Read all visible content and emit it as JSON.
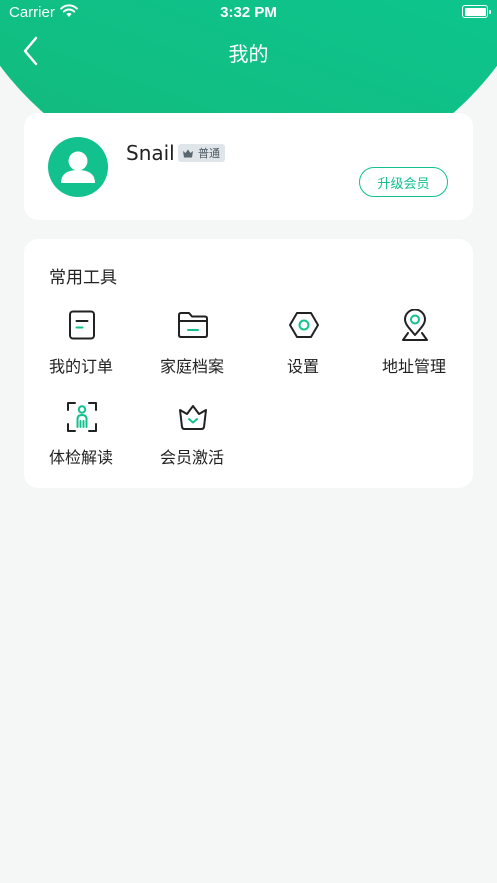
{
  "status_bar": {
    "carrier": "Carrier",
    "time": "3:32 PM"
  },
  "nav": {
    "title": "我的",
    "back_icon": "chevron-left-icon"
  },
  "profile": {
    "username": "Snail",
    "badge": {
      "icon": "crown-icon",
      "label": "普通"
    },
    "upgrade_label": "升级会员",
    "avatar_icon": "user-avatar-icon"
  },
  "tools": {
    "title": "常用工具",
    "items": [
      {
        "label": "我的订单",
        "icon": "order-icon"
      },
      {
        "label": "家庭档案",
        "icon": "folder-icon"
      },
      {
        "label": "设置",
        "icon": "settings-hexagon-icon"
      },
      {
        "label": "地址管理",
        "icon": "location-pin-icon"
      },
      {
        "label": "体检解读",
        "icon": "body-scan-icon"
      },
      {
        "label": "会员激活",
        "icon": "member-basket-icon"
      }
    ]
  },
  "colors": {
    "accent": "#13c18f",
    "header_gradient_start": "#07d2a4",
    "header_gradient_end": "#15b87a",
    "background": "#f5f6f6"
  }
}
